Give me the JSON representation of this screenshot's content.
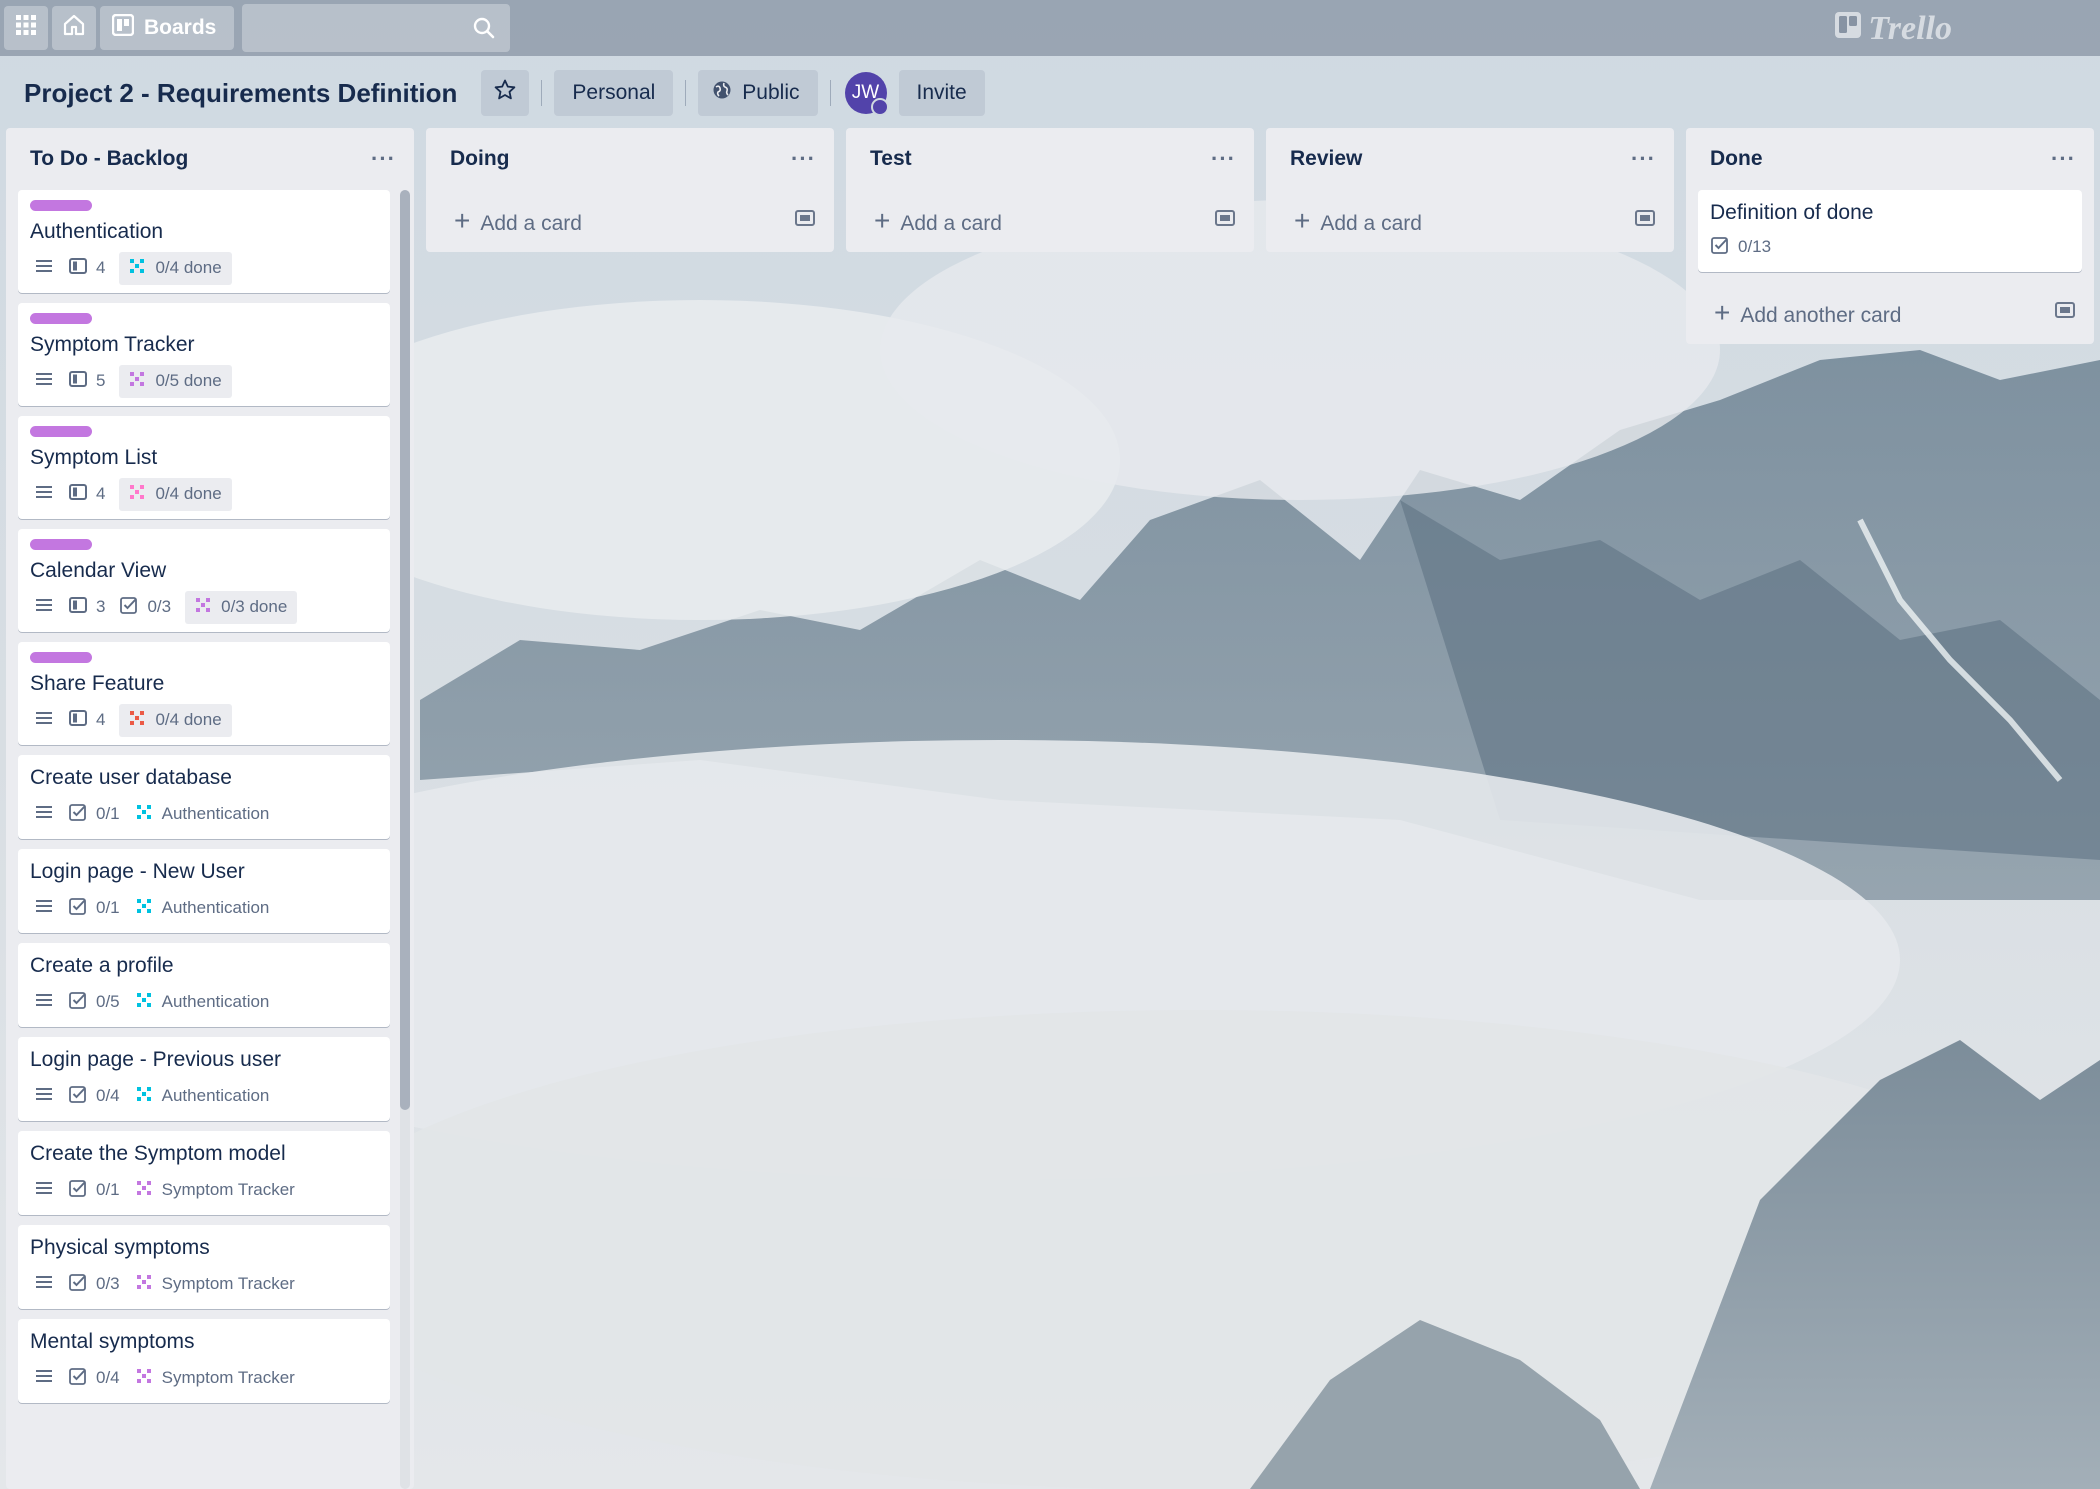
{
  "header": {
    "boards_label": "Boards",
    "logo_text": "Trello"
  },
  "board": {
    "title": "Project 2 - Requirements Definition",
    "visibility_personal": "Personal",
    "visibility_public": "Public",
    "avatar_initials": "JW",
    "invite_label": "Invite"
  },
  "lists": [
    {
      "title": "To Do - Backlog",
      "cards": [
        {
          "title": "Authentication",
          "labeled": true,
          "attachments": "4",
          "checklist": "",
          "tag": "0/4 done",
          "tag_color": "#00c2e0",
          "tag_pill": true
        },
        {
          "title": "Symptom Tracker",
          "labeled": true,
          "attachments": "5",
          "checklist": "",
          "tag": "0/5 done",
          "tag_color": "#c377e0",
          "tag_pill": true
        },
        {
          "title": "Symptom List",
          "labeled": true,
          "attachments": "4",
          "checklist": "",
          "tag": "0/4 done",
          "tag_color": "#ff78cb",
          "tag_pill": true
        },
        {
          "title": "Calendar View",
          "labeled": true,
          "attachments": "3",
          "checklist": "0/3",
          "tag": "0/3 done",
          "tag_color": "#c377e0",
          "tag_pill": true
        },
        {
          "title": "Share Feature",
          "labeled": true,
          "attachments": "4",
          "checklist": "",
          "tag": "0/4 done",
          "tag_color": "#eb5a46",
          "tag_pill": true
        },
        {
          "title": "Create user database",
          "labeled": false,
          "attachments": "",
          "checklist": "0/1",
          "tag": "Authentication",
          "tag_color": "#00c2e0",
          "tag_pill": false
        },
        {
          "title": "Login page - New User",
          "labeled": false,
          "attachments": "",
          "checklist": "0/1",
          "tag": "Authentication",
          "tag_color": "#00c2e0",
          "tag_pill": false
        },
        {
          "title": "Create a profile",
          "labeled": false,
          "attachments": "",
          "checklist": "0/5",
          "tag": "Authentication",
          "tag_color": "#00c2e0",
          "tag_pill": false
        },
        {
          "title": "Login page - Previous user",
          "labeled": false,
          "attachments": "",
          "checklist": "0/4",
          "tag": "Authentication",
          "tag_color": "#00c2e0",
          "tag_pill": false
        },
        {
          "title": "Create the Symptom model",
          "labeled": false,
          "attachments": "",
          "checklist": "0/1",
          "tag": "Symptom Tracker",
          "tag_color": "#c377e0",
          "tag_pill": false
        },
        {
          "title": "Physical symptoms",
          "labeled": false,
          "attachments": "",
          "checklist": "0/3",
          "tag": "Symptom Tracker",
          "tag_color": "#c377e0",
          "tag_pill": false
        },
        {
          "title": "Mental symptoms",
          "labeled": false,
          "attachments": "",
          "checklist": "0/4",
          "tag": "Symptom Tracker",
          "tag_color": "#c377e0",
          "tag_pill": false
        }
      ]
    },
    {
      "title": "Doing",
      "add_label": "Add a card"
    },
    {
      "title": "Test",
      "add_label": "Add a card"
    },
    {
      "title": "Review",
      "add_label": "Add a card"
    },
    {
      "title": "Done",
      "cards": [
        {
          "title": "Definition of done",
          "checklist": "0/13"
        }
      ],
      "add_label": "Add another card"
    }
  ]
}
